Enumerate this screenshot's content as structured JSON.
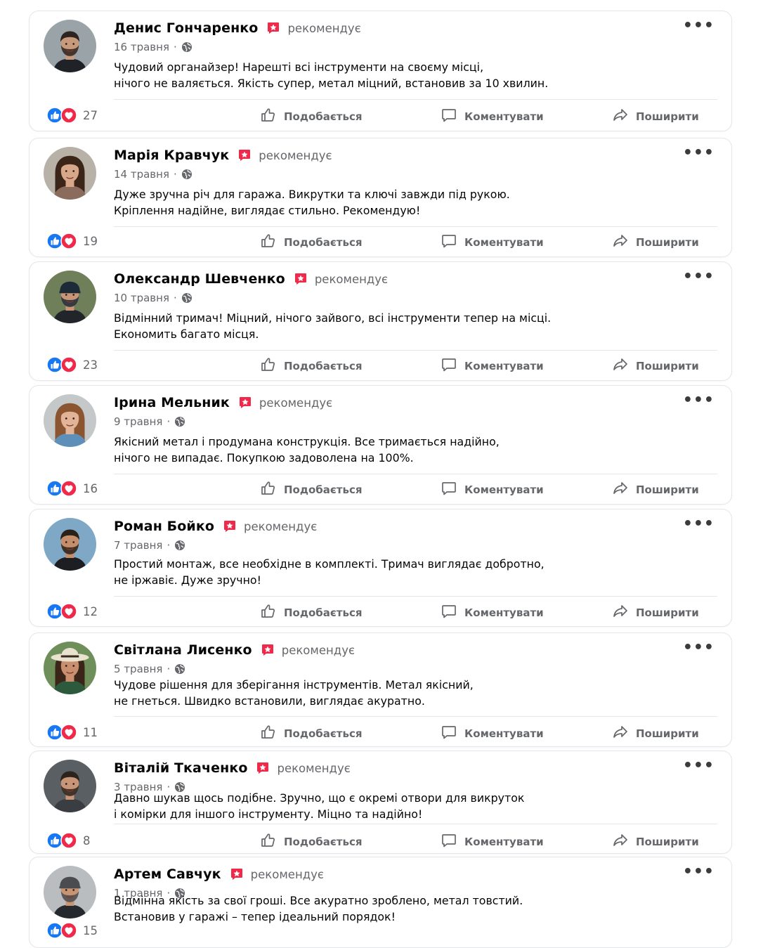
{
  "recommends_label": "рекомендує",
  "actions": {
    "like": "Подобається",
    "comment": "Коментувати",
    "share": "Поширити"
  },
  "colors": {
    "like_blue": "#1877f2",
    "heart_red": "#f02849",
    "recommend_red": "#f02849",
    "muted": "#65676b"
  },
  "posts": [
    {
      "author": "Денис Гончаренко",
      "date": "16 травня",
      "lines": [
        "Чудовий органайзер! Нарешті всі інструменти на своєму місці,",
        "нічого не валяється. Якість супер, метал міцний, встановив за 10 хвилин."
      ],
      "reactions": "27",
      "avatar": {
        "skin": "#c89a7c",
        "hair": "#2d2420",
        "shirt": "#1f2226",
        "bg": "#9aa3a8",
        "beard": true,
        "cap": false,
        "hat": false,
        "long_hair": false
      }
    },
    {
      "author": "Марія Кравчук",
      "date": "14 травня",
      "lines": [
        "Дуже зручна річ для гаража. Викрутки та ключі завжди під рукою.",
        "Кріплення надійне, виглядає стильно. Рекомендую!"
      ],
      "reactions": "19",
      "avatar": {
        "skin": "#d8a78a",
        "hair": "#3b2418",
        "shirt": "#8a6b5c",
        "bg": "#b7b1a8",
        "beard": false,
        "cap": false,
        "hat": false,
        "long_hair": true
      }
    },
    {
      "author": "Олександр Шевченко",
      "date": "10 травня",
      "lines": [
        "Відмінний тримач! Міцний, нічого зайвого, всі інструменти тепер на місці.",
        "Економить багато місця."
      ],
      "reactions": "23",
      "avatar": {
        "skin": "#c99576",
        "hair": "#1d2a38",
        "shirt": "#22262b",
        "bg": "#6e7f5a",
        "beard": true,
        "cap": true,
        "hat": false,
        "long_hair": false
      }
    },
    {
      "author": "Ірина Мельник",
      "date": "9 травня",
      "lines": [
        "Якісний метал і продумана конструкція. Все тримається надійно,",
        "нічого не випадає. Покупкою задоволена на 100%."
      ],
      "reactions": "16",
      "avatar": {
        "skin": "#e2b396",
        "hair": "#8a5530",
        "shirt": "#5d8fb8",
        "bg": "#c4c8c8",
        "beard": false,
        "cap": false,
        "hat": false,
        "long_hair": true
      }
    },
    {
      "author": "Роман Бойко",
      "date": "7 травня",
      "lines": [
        "Простий монтаж, все необхідне в комплекті. Тримач виглядає добротно,",
        "не іржавіє. Дуже зручно!"
      ],
      "reactions": "12",
      "avatar": {
        "skin": "#c48e6c",
        "hair": "#2a2018",
        "shirt": "#1c1e22",
        "bg": "#7fa7c6",
        "beard": true,
        "cap": false,
        "hat": false,
        "long_hair": false
      }
    },
    {
      "author": "Світлана Лисенко",
      "date": "5 травня",
      "lines": [
        "Чудове рішення для зберігання інструментів. Метал якісний,",
        "не гнеться. Швидко встановили, виглядає акуратно."
      ],
      "reactions": "11",
      "avatar": {
        "skin": "#c98f6e",
        "hair": "#3a2518",
        "shirt": "#2d5a3c",
        "bg": "#6f8f5a",
        "beard": false,
        "cap": false,
        "hat": true,
        "long_hair": true
      }
    },
    {
      "author": "Віталій Ткаченко",
      "date": "3 травня",
      "lines": [
        "Давно шукав щось подібне. Зручно, що є окремі отвори для викруток",
        "і комірки для іншого інструменту. Міцно та надійно!"
      ],
      "reactions": "8",
      "avatar": {
        "skin": "#c99578",
        "hair": "#2c231c",
        "shirt": "#3a3d42",
        "bg": "#5a5f63",
        "beard": true,
        "cap": false,
        "hat": false,
        "long_hair": false
      }
    },
    {
      "author": "Артем Савчук",
      "date": "1 травня",
      "lines": [
        "Відмінна якість за свої гроші. Все акуратно зроблено, метал товстий.",
        "Встановив у гаражі – тепер ідеальний порядок!"
      ],
      "reactions": "15",
      "avatar": {
        "skin": "#c79474",
        "hair": "#4a4c50",
        "shirt": "#25282c",
        "bg": "#b9bdbf",
        "beard": true,
        "cap": true,
        "hat": false,
        "long_hair": false
      }
    }
  ]
}
